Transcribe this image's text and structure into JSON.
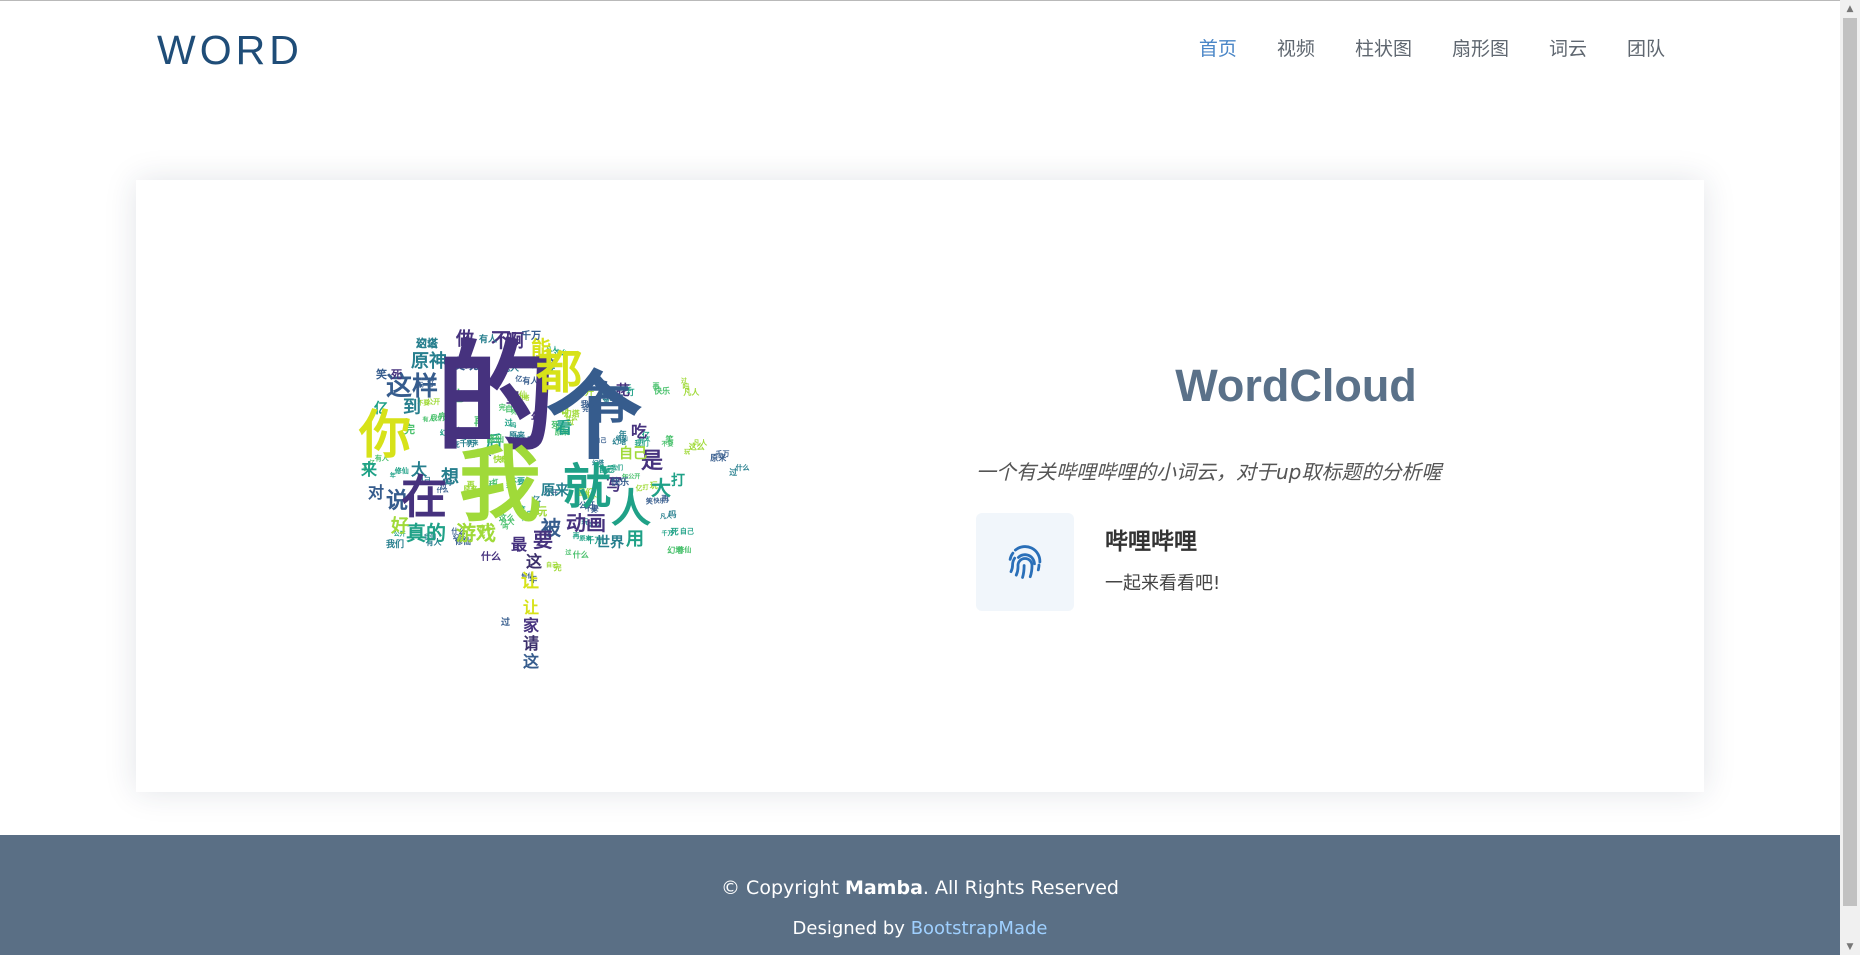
{
  "header": {
    "logo": "WORD",
    "nav": [
      "首页",
      "视频",
      "柱状图",
      "扇形图",
      "词云",
      "团队"
    ]
  },
  "main": {
    "wordcloud_words": {
      "large": [
        "的",
        "我",
        "个",
        "就",
        "在",
        "你",
        "都",
        "有",
        "人"
      ],
      "medium": [
        "这样",
        "是",
        "大",
        "说",
        "游戏",
        "真的",
        "被",
        "动画",
        "用",
        "世界",
        "原神",
        "发现",
        "到",
        "看",
        "给",
        "吃",
        "要",
        "让",
        "不",
        "能",
        "做",
        "啊",
        "想",
        "太",
        "来",
        "好",
        "对",
        "后",
        "最",
        "这",
        "也",
        "里",
        "花",
        "写"
      ],
      "small": [
        "幻塔",
        "笑",
        "死",
        "亿",
        "吗",
        "年",
        "再",
        "完",
        "玩",
        "什么",
        "不要",
        "千万",
        "有人",
        "凡人",
        "修仙",
        "快乐",
        "自己",
        "打",
        "过",
        "公开",
        "原来",
        "我们",
        "这么"
      ]
    },
    "title": "WordCloud",
    "subtitle": "一个有关哔哩哔哩的小词云，对于up取标题的分析喔",
    "feature": {
      "icon": "fingerprint-icon",
      "title": "哔哩哔哩",
      "description": "一起来看看吧!"
    }
  },
  "footer": {
    "copyright_prefix": "© Copyright ",
    "copyright_brand": "Mamba",
    "copyright_suffix": ". All Rights Reserved",
    "credits_prefix": "Designed by ",
    "credits_link": "BootstrapMade"
  },
  "colors": {
    "logo": "#1f4d78",
    "nav_active": "#4a86c7",
    "title": "#5a7189",
    "footer_bg": "#5a6f85",
    "link": "#9fd0ff",
    "cloud_palette": [
      "#3b2f6b",
      "#46327e",
      "#365c8d",
      "#277f8e",
      "#1fa187",
      "#4ac16d",
      "#a0da39",
      "#d7e219",
      "#fde725"
    ]
  }
}
